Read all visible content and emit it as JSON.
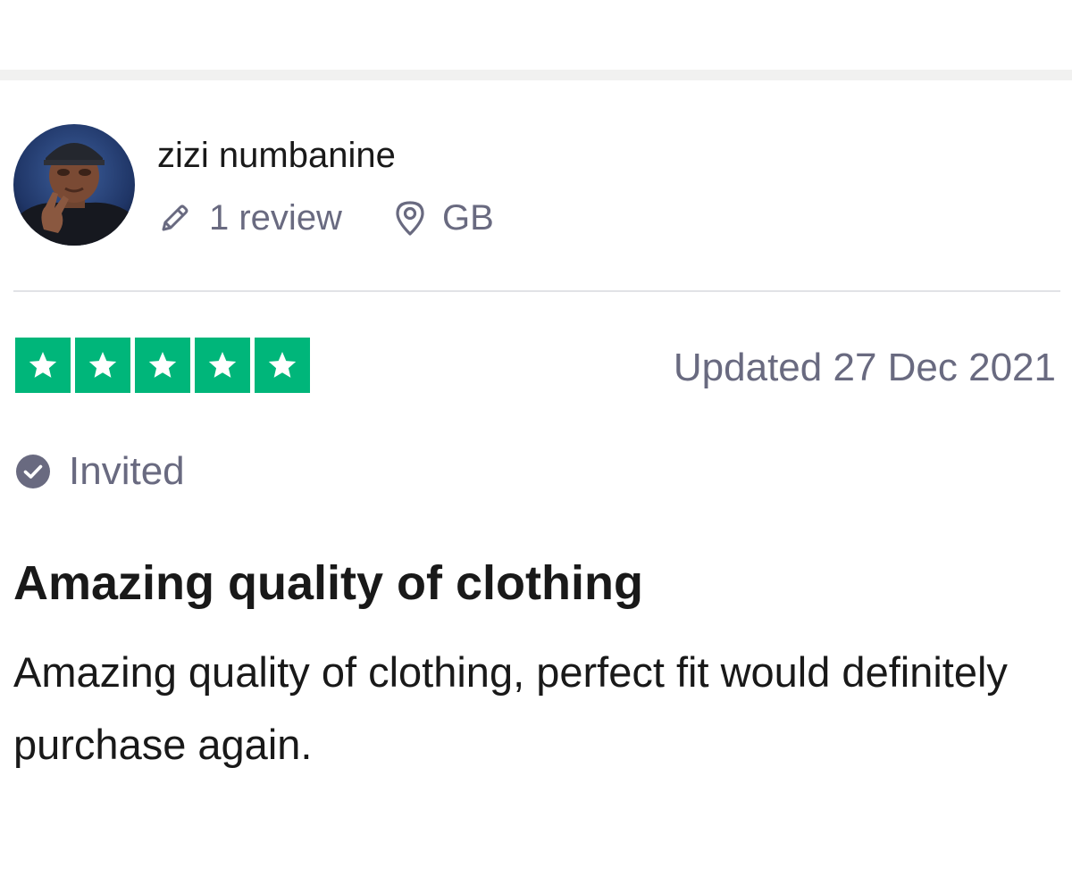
{
  "reviewer": {
    "name": "zizi numbanine",
    "review_count": "1 review",
    "location": "GB"
  },
  "review": {
    "rating": 5,
    "rating_max": 5,
    "date_label": "Updated 27 Dec 2021",
    "invited_label": "Invited",
    "title": "Amazing quality of clothing",
    "body": "Amazing quality of clothing, perfect fit would definitely purchase again."
  },
  "icons": {
    "review_count": "pencil-icon",
    "location": "location-pin-icon",
    "invited": "check-circle-icon",
    "star": "star-icon"
  },
  "colors": {
    "star_green": "#00b67a",
    "muted_text": "#696a80",
    "primary_text": "#191919"
  }
}
